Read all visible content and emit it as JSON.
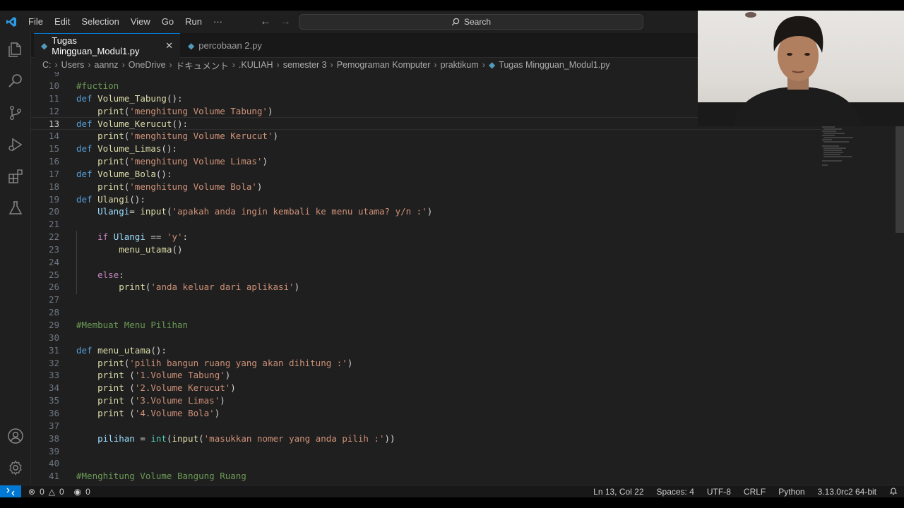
{
  "menu": {
    "items": [
      "File",
      "Edit",
      "Selection",
      "View",
      "Go",
      "Run",
      "···"
    ],
    "back_icon": "arrow-left-icon",
    "forward_icon": "arrow-right-icon",
    "search_label": "Search"
  },
  "tabs": [
    {
      "label": "Tugas Mingguan_Modul1.py",
      "close": "✕",
      "active": true
    },
    {
      "label": "percobaan 2.py",
      "active": false
    }
  ],
  "breadcrumb": [
    "C:",
    "Users",
    "aannz",
    "OneDrive",
    "ドキュメント",
    ".KULIAH",
    "semester 3",
    "Pemograman Komputer",
    "praktikum",
    "Tugas Mingguan_Modul1.py"
  ],
  "editor": {
    "current_line": 13,
    "lines": [
      {
        "n": "9",
        "tokens": []
      },
      {
        "n": "10",
        "tokens": [
          [
            "cm",
            "#fuction"
          ]
        ]
      },
      {
        "n": "11",
        "tokens": [
          [
            "kw",
            "def"
          ],
          [
            "op",
            " "
          ],
          [
            "fn",
            "Volume_Tabung"
          ],
          [
            "op",
            "():"
          ]
        ]
      },
      {
        "n": "12",
        "tokens": [
          [
            "op",
            "    "
          ],
          [
            "fn",
            "print"
          ],
          [
            "op",
            "("
          ],
          [
            "str",
            "'menghitung Volume Tabung'"
          ],
          [
            "op",
            ")"
          ]
        ]
      },
      {
        "n": "13",
        "tokens": [
          [
            "kw",
            "def"
          ],
          [
            "op",
            " "
          ],
          [
            "fn",
            "Volume_Kerucut"
          ],
          [
            "op",
            "():"
          ]
        ]
      },
      {
        "n": "14",
        "tokens": [
          [
            "op",
            "    "
          ],
          [
            "fn",
            "print"
          ],
          [
            "op",
            "("
          ],
          [
            "str",
            "'menghitung Volume Kerucut'"
          ],
          [
            "op",
            ")"
          ]
        ]
      },
      {
        "n": "15",
        "tokens": [
          [
            "kw",
            "def"
          ],
          [
            "op",
            " "
          ],
          [
            "fn",
            "Volume_Limas"
          ],
          [
            "op",
            "():"
          ]
        ]
      },
      {
        "n": "16",
        "tokens": [
          [
            "op",
            "    "
          ],
          [
            "fn",
            "print"
          ],
          [
            "op",
            "("
          ],
          [
            "str",
            "'menghitung Volume Limas'"
          ],
          [
            "op",
            ")"
          ]
        ]
      },
      {
        "n": "17",
        "tokens": [
          [
            "kw",
            "def"
          ],
          [
            "op",
            " "
          ],
          [
            "fn",
            "Volume_Bola"
          ],
          [
            "op",
            "():"
          ]
        ]
      },
      {
        "n": "18",
        "tokens": [
          [
            "op",
            "    "
          ],
          [
            "fn",
            "print"
          ],
          [
            "op",
            "("
          ],
          [
            "str",
            "'menghitung Volume Bola'"
          ],
          [
            "op",
            ")"
          ]
        ]
      },
      {
        "n": "19",
        "tokens": [
          [
            "kw",
            "def"
          ],
          [
            "op",
            " "
          ],
          [
            "fn",
            "Ulangi"
          ],
          [
            "op",
            "():"
          ]
        ]
      },
      {
        "n": "20",
        "tokens": [
          [
            "op",
            "    "
          ],
          [
            "var",
            "Ulangi"
          ],
          [
            "op",
            "= "
          ],
          [
            "fn",
            "input"
          ],
          [
            "op",
            "("
          ],
          [
            "str",
            "'apakah anda ingin kembali ke menu utama? y/n :'"
          ],
          [
            "op",
            ")"
          ]
        ]
      },
      {
        "n": "21",
        "tokens": []
      },
      {
        "n": "22",
        "tokens": [
          [
            "op",
            "    "
          ],
          [
            "ctrl",
            "if"
          ],
          [
            "op",
            " "
          ],
          [
            "var",
            "Ulangi"
          ],
          [
            "op",
            " == "
          ],
          [
            "str",
            "'y'"
          ],
          [
            "op",
            ":"
          ]
        ]
      },
      {
        "n": "23",
        "tokens": [
          [
            "op",
            "        "
          ],
          [
            "fn",
            "menu_utama"
          ],
          [
            "op",
            "()"
          ]
        ]
      },
      {
        "n": "24",
        "tokens": []
      },
      {
        "n": "25",
        "tokens": [
          [
            "op",
            "    "
          ],
          [
            "ctrl",
            "else"
          ],
          [
            "op",
            ":"
          ]
        ]
      },
      {
        "n": "26",
        "tokens": [
          [
            "op",
            "        "
          ],
          [
            "fn",
            "print"
          ],
          [
            "op",
            "("
          ],
          [
            "str",
            "'anda keluar dari aplikasi'"
          ],
          [
            "op",
            ")"
          ]
        ]
      },
      {
        "n": "27",
        "tokens": []
      },
      {
        "n": "28",
        "tokens": []
      },
      {
        "n": "29",
        "tokens": [
          [
            "cm",
            "#Membuat Menu Pilihan"
          ]
        ]
      },
      {
        "n": "30",
        "tokens": []
      },
      {
        "n": "31",
        "tokens": [
          [
            "kw",
            "def"
          ],
          [
            "op",
            " "
          ],
          [
            "fn",
            "menu_utama"
          ],
          [
            "op",
            "():"
          ]
        ]
      },
      {
        "n": "32",
        "tokens": [
          [
            "op",
            "    "
          ],
          [
            "fn",
            "print"
          ],
          [
            "op",
            "("
          ],
          [
            "str",
            "'pilih bangun ruang yang akan dihitung :'"
          ],
          [
            "op",
            ")"
          ]
        ]
      },
      {
        "n": "33",
        "tokens": [
          [
            "op",
            "    "
          ],
          [
            "fn",
            "print"
          ],
          [
            "op",
            " ("
          ],
          [
            "str",
            "'1.Volume Tabung'"
          ],
          [
            "op",
            ")"
          ]
        ]
      },
      {
        "n": "34",
        "tokens": [
          [
            "op",
            "    "
          ],
          [
            "fn",
            "print"
          ],
          [
            "op",
            " ("
          ],
          [
            "str",
            "'2.Volume Kerucut'"
          ],
          [
            "op",
            ")"
          ]
        ]
      },
      {
        "n": "35",
        "tokens": [
          [
            "op",
            "    "
          ],
          [
            "fn",
            "print"
          ],
          [
            "op",
            " ("
          ],
          [
            "str",
            "'3.Volume Limas'"
          ],
          [
            "op",
            ")"
          ]
        ]
      },
      {
        "n": "36",
        "tokens": [
          [
            "op",
            "    "
          ],
          [
            "fn",
            "print"
          ],
          [
            "op",
            " ("
          ],
          [
            "str",
            "'4.Volume Bola'"
          ],
          [
            "op",
            ")"
          ]
        ]
      },
      {
        "n": "37",
        "tokens": []
      },
      {
        "n": "38",
        "tokens": [
          [
            "op",
            "    "
          ],
          [
            "var",
            "pilihan"
          ],
          [
            "op",
            " = "
          ],
          [
            "bi",
            "int"
          ],
          [
            "op",
            "("
          ],
          [
            "fn",
            "input"
          ],
          [
            "op",
            "("
          ],
          [
            "str",
            "'masukkan nomer yang anda pilih :'"
          ],
          [
            "op",
            "))"
          ]
        ]
      },
      {
        "n": "39",
        "tokens": []
      },
      {
        "n": "40",
        "tokens": []
      },
      {
        "n": "41",
        "tokens": [
          [
            "cm",
            "#Menghitung Volume Bangung Ruang"
          ]
        ]
      }
    ]
  },
  "status": {
    "errors": "0",
    "warnings": "0",
    "ports": "0",
    "position": "Ln 13, Col 22",
    "spaces": "Spaces: 4",
    "encoding": "UTF-8",
    "eol": "CRLF",
    "language": "Python",
    "interpreter": "3.13.0rc2 64-bit"
  },
  "colors": {
    "accent": "#0078d4",
    "editor_bg": "#1f1f1f",
    "keyword": "#569cd6",
    "function": "#dcdcaa",
    "string": "#ce9178",
    "comment": "#6a9955"
  }
}
